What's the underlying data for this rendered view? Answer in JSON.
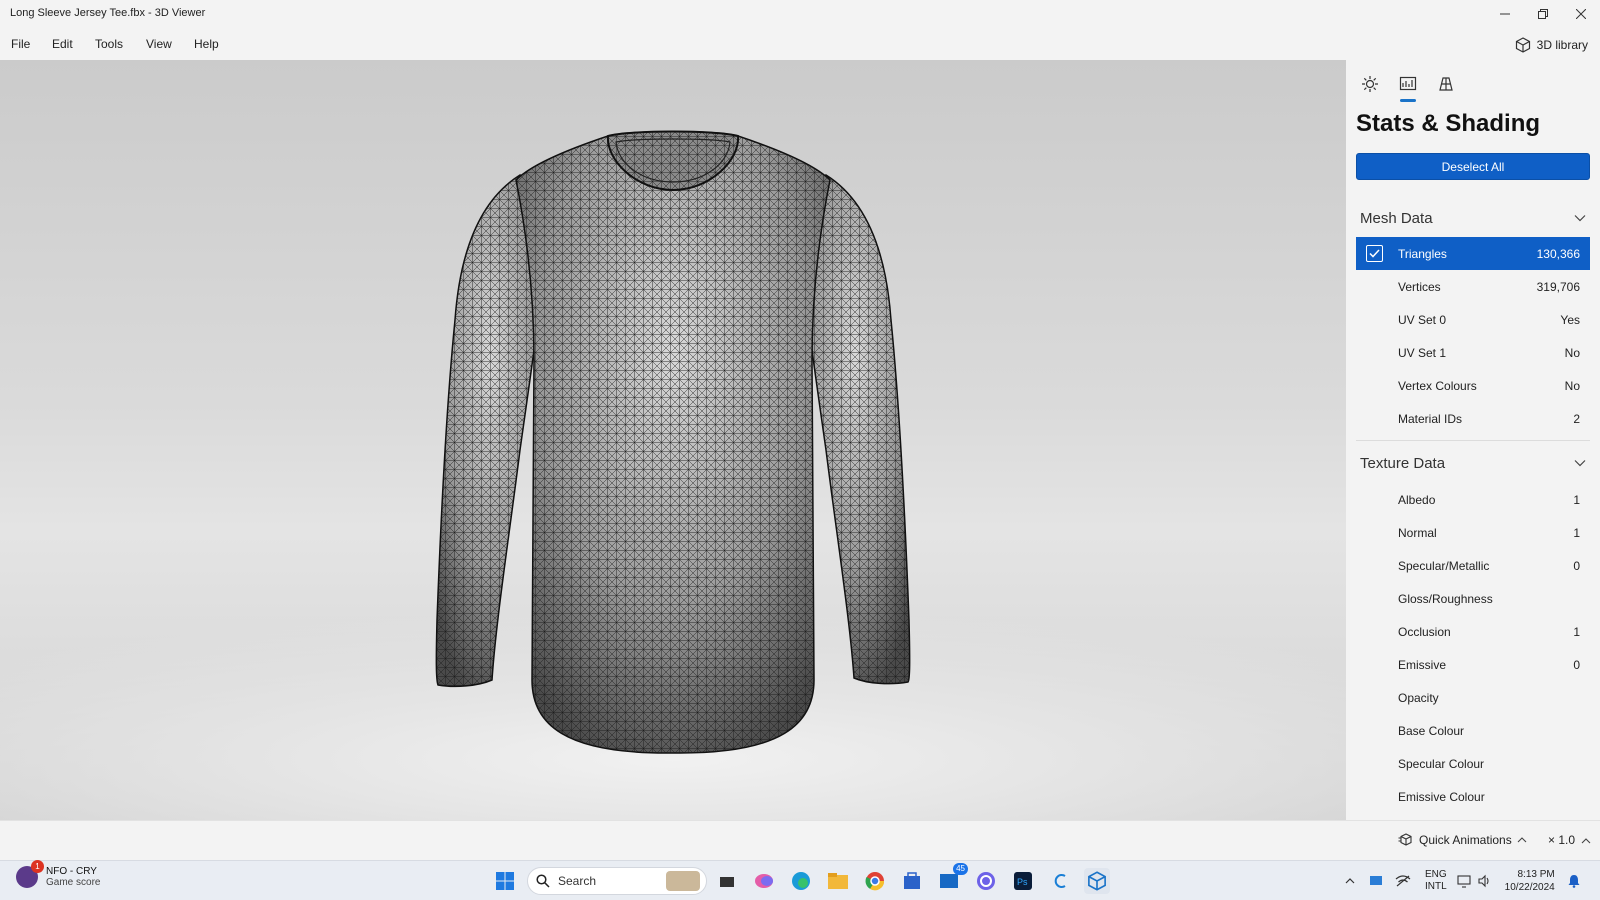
{
  "window": {
    "title": "Long Sleeve Jersey Tee.fbx - 3D Viewer"
  },
  "menu": {
    "items": [
      "File",
      "Edit",
      "Tools",
      "View",
      "Help"
    ],
    "library_label": "3D library"
  },
  "panel": {
    "tabs": [
      "lighting-icon",
      "stats-icon",
      "grid-icon"
    ],
    "title": "Stats & Shading",
    "deselect_label": "Deselect All",
    "mesh": {
      "heading": "Mesh Data",
      "rows": [
        {
          "label": "Triangles",
          "value": "130,366",
          "checked": true
        },
        {
          "label": "Vertices",
          "value": "319,706"
        },
        {
          "label": "UV Set 0",
          "value": "Yes"
        },
        {
          "label": "UV Set 1",
          "value": "No"
        },
        {
          "label": "Vertex Colours",
          "value": "No"
        },
        {
          "label": "Material IDs",
          "value": "2"
        }
      ]
    },
    "texture": {
      "heading": "Texture Data",
      "rows": [
        {
          "label": "Albedo",
          "value": "1"
        },
        {
          "label": "Normal",
          "value": "1"
        },
        {
          "label": "Specular/Metallic",
          "value": "0"
        },
        {
          "label": "Gloss/Roughness",
          "value": ""
        },
        {
          "label": "Occlusion",
          "value": "1"
        },
        {
          "label": "Emissive",
          "value": "0"
        },
        {
          "label": "Opacity",
          "value": ""
        },
        {
          "label": "Base Colour",
          "value": ""
        },
        {
          "label": "Specular Colour",
          "value": ""
        },
        {
          "label": "Emissive Colour",
          "value": ""
        }
      ]
    }
  },
  "bottom": {
    "quick_animations": "Quick Animations",
    "speed": "× 1.0"
  },
  "taskbar": {
    "game_badge": "1",
    "game_title": "NFO - CRY",
    "game_subtitle": "Game score",
    "search_placeholder": "Search",
    "outlook_badge": "45",
    "lang1": "ENG",
    "lang2": "INTL",
    "time": "8:13 PM",
    "date": "10/22/2024"
  },
  "colors": {
    "accent": "#0f5fc6",
    "viewport_bg": "#d6d6d6"
  }
}
